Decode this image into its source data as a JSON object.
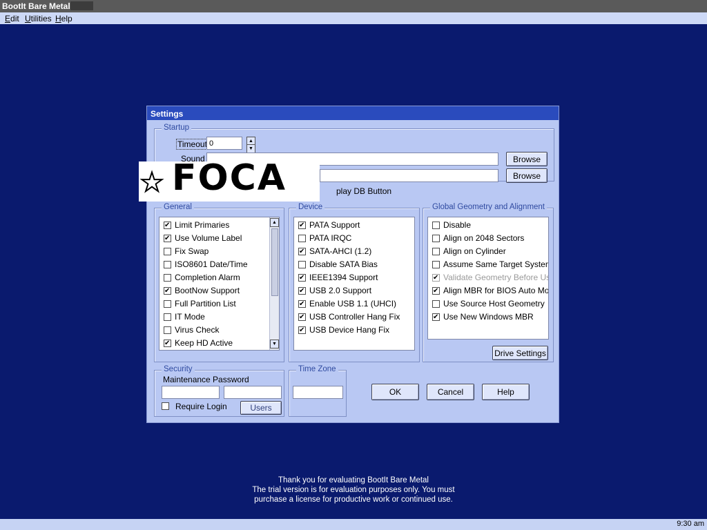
{
  "app": {
    "title": "BootIt Bare Metal"
  },
  "menu": [
    {
      "pre": "",
      "u": "E",
      "post": "dit"
    },
    {
      "pre": "",
      "u": "U",
      "post": "tilities"
    },
    {
      "pre": "",
      "u": "H",
      "post": "elp"
    }
  ],
  "dialog": {
    "title": "Settings"
  },
  "startup": {
    "label": "Startup",
    "timeout_label": "Timeout",
    "timeout_value": "0",
    "sound_label": "Sound",
    "sound_value": "",
    "field2_value": "",
    "browse_label": "Browse",
    "display_db_button_label": "play DB Button"
  },
  "general": {
    "label": "General",
    "items": [
      {
        "label": "Limit Primaries",
        "checked": true
      },
      {
        "label": "Use Volume Label",
        "checked": true
      },
      {
        "label": "Fix Swap",
        "checked": false
      },
      {
        "label": "ISO8601 Date/Time",
        "checked": false
      },
      {
        "label": "Completion Alarm",
        "checked": false
      },
      {
        "label": "BootNow Support",
        "checked": true
      },
      {
        "label": "Full Partition List",
        "checked": false
      },
      {
        "label": "IT Mode",
        "checked": false
      },
      {
        "label": "Virus Check",
        "checked": false
      },
      {
        "label": "Keep HD Active",
        "checked": true
      }
    ]
  },
  "device": {
    "label": "Device",
    "items": [
      {
        "label": "PATA Support",
        "checked": true
      },
      {
        "label": "PATA IRQC",
        "checked": false
      },
      {
        "label": "SATA-AHCI (1.2)",
        "checked": true
      },
      {
        "label": "Disable SATA Bias",
        "checked": false
      },
      {
        "label": "IEEE1394 Support",
        "checked": true
      },
      {
        "label": "USB 2.0 Support",
        "checked": true
      },
      {
        "label": "Enable USB 1.1 (UHCI)",
        "checked": true
      },
      {
        "label": "USB Controller Hang Fix",
        "checked": true
      },
      {
        "label": "USB Device Hang Fix",
        "checked": true
      }
    ]
  },
  "geometry": {
    "label": "Global Geometry and Alignment",
    "items": [
      {
        "label": "Disable",
        "checked": false,
        "disabled": false
      },
      {
        "label": "Align on 2048 Sectors",
        "checked": false,
        "disabled": false
      },
      {
        "label": "Align on Cylinder",
        "checked": false,
        "disabled": false
      },
      {
        "label": "Assume Same Target System",
        "checked": false,
        "disabled": false
      },
      {
        "label": "Validate Geometry Before Use",
        "checked": true,
        "disabled": true
      },
      {
        "label": "Align MBR for BIOS Auto Mode",
        "checked": true,
        "disabled": false
      },
      {
        "label": "Use Source Host Geometry",
        "checked": false,
        "disabled": false
      },
      {
        "label": "Use New Windows MBR",
        "checked": true,
        "disabled": false
      }
    ],
    "drive_settings_label": "Drive Settings"
  },
  "security": {
    "label": "Security",
    "password_label": "Maintenance Password",
    "password1": "",
    "password2": "",
    "require_login_label": "Require Login",
    "require_login_checked": false,
    "users_label": "Users"
  },
  "timezone": {
    "label": "Time Zone",
    "value": ""
  },
  "buttons": {
    "ok": "OK",
    "cancel": "Cancel",
    "help": "Help"
  },
  "overlay": {
    "text": "FOCA"
  },
  "footer": {
    "line1": "Thank you for evaluating BootIt Bare Metal",
    "line2": "The trial version is for evaluation purposes only.  You must",
    "line3": "purchase a license for productive work or continued use."
  },
  "taskbar": {
    "clock": "9:30 am"
  },
  "colors": {
    "desktop": "#0a1a6e",
    "dialog_bg": "#b9c8f3",
    "title_bar": "#2a4bbd"
  }
}
